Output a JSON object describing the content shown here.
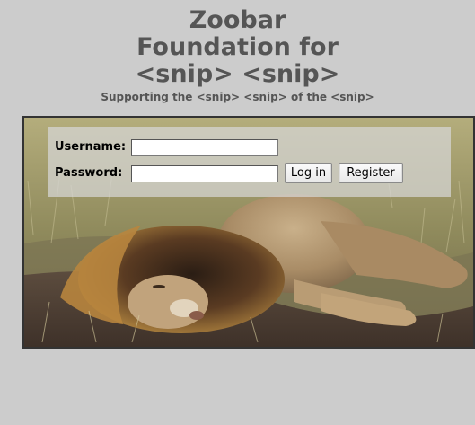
{
  "site": {
    "title_lines": [
      "Zoobar",
      "Foundation for",
      "<snip> <snip>"
    ],
    "tagline": "Supporting the <snip> <snip> of the <snip>"
  },
  "login": {
    "username_label": "Username:",
    "password_label": "Password:",
    "username_value": "",
    "password_value": "",
    "login_button": "Log in",
    "register_button": "Register"
  },
  "banner": {
    "image": "sleeping-lion-in-grass"
  },
  "colors": {
    "background": "#cccccc",
    "title_text": "#555555",
    "banner_border": "#333333"
  }
}
